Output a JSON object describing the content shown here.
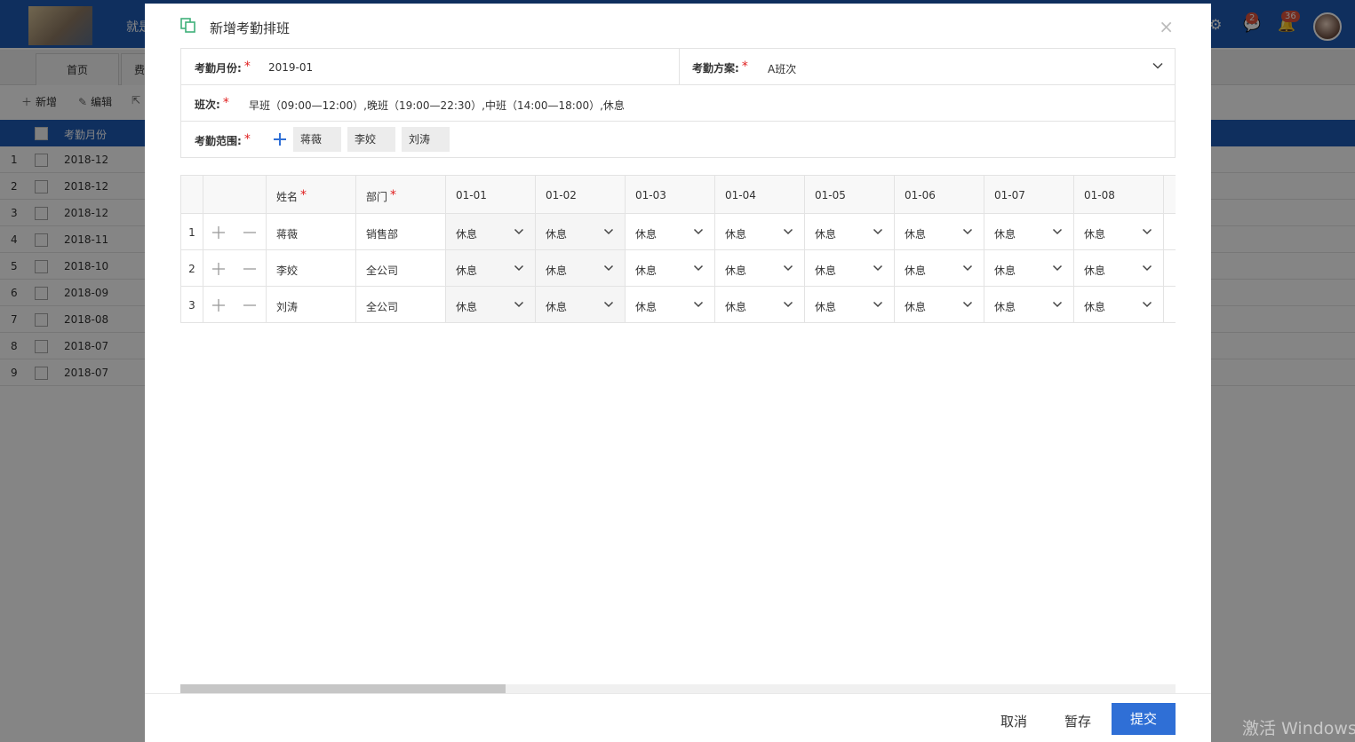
{
  "background": {
    "app_title": "就是",
    "tabs": [
      "首页",
      "费"
    ],
    "toolbar": [
      "新增",
      "编辑",
      ""
    ],
    "column_header": "考勤月份",
    "rows": [
      {
        "n": "1",
        "month": "2018-12"
      },
      {
        "n": "2",
        "month": "2018-12"
      },
      {
        "n": "3",
        "month": "2018-12"
      },
      {
        "n": "4",
        "month": "2018-11"
      },
      {
        "n": "5",
        "month": "2018-10"
      },
      {
        "n": "6",
        "month": "2018-09"
      },
      {
        "n": "7",
        "month": "2018-08"
      },
      {
        "n": "8",
        "month": "2018-07"
      },
      {
        "n": "9",
        "month": "2018-07"
      }
    ],
    "badges": {
      "messages": "2",
      "notifications": "36"
    }
  },
  "modal": {
    "title": "新增考勤排班",
    "close_glyph": "×",
    "form": {
      "month_label": "考勤月份:",
      "month_value": "2019-01",
      "plan_label": "考勤方案:",
      "plan_value": "A班次",
      "shift_label": "班次:",
      "shift_value": "早班（09:00—12:00）,晚班（19:00—22:30）,中班（14:00—18:00）,休息",
      "scope_label": "考勤范围:",
      "scope_tags": [
        "蒋薇",
        "李姣",
        "刘涛"
      ],
      "required_mark": "*"
    },
    "grid": {
      "headers": {
        "name": "姓名",
        "dept": "部门",
        "days": [
          "01-01",
          "01-02",
          "01-03",
          "01-04",
          "01-05",
          "01-06",
          "01-07",
          "01-08"
        ]
      },
      "rows": [
        {
          "idx": "1",
          "name": "蒋薇",
          "dept": "销售部",
          "shifts": [
            "休息",
            "休息",
            "休息",
            "休息",
            "休息",
            "休息",
            "休息",
            "休息"
          ]
        },
        {
          "idx": "2",
          "name": "李姣",
          "dept": "全公司",
          "shifts": [
            "休息",
            "休息",
            "休息",
            "休息",
            "休息",
            "休息",
            "休息",
            "休息"
          ]
        },
        {
          "idx": "3",
          "name": "刘涛",
          "dept": "全公司",
          "shifts": [
            "休息",
            "休息",
            "休息",
            "休息",
            "休息",
            "休息",
            "休息",
            "休息"
          ]
        }
      ]
    },
    "footer": {
      "cancel": "取消",
      "save_draft": "暂存",
      "submit": "提交"
    }
  },
  "watermark": "激活 Windows",
  "colors": {
    "primary": "#2f6fd6",
    "header_blue": "#1e5bb5",
    "required": "#e02020",
    "icon_green": "#3fb07a"
  }
}
